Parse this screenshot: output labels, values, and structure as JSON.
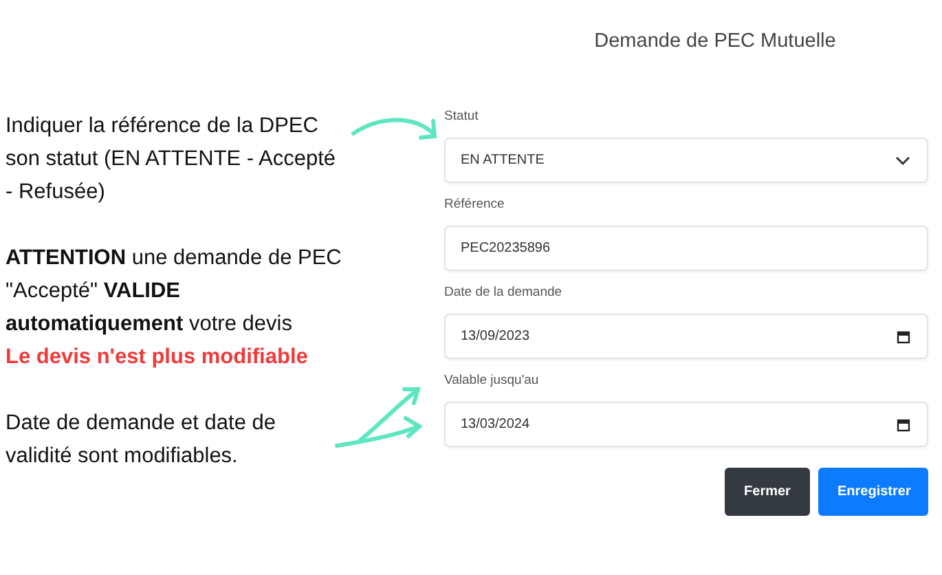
{
  "notes": [
    {
      "parts": [
        {
          "kind": "text",
          "text": "Indiquer la référence de la DPEC son statut (EN ATTENTE - Accepté - Refusée)"
        }
      ]
    },
    {
      "parts": [
        {
          "kind": "text",
          "text": "**ATTENTION** une demande de PEC \"Accepté\" **VALIDE automatiquement** votre devis"
        },
        {
          "kind": "warning",
          "text": "Le devis n'est plus modifiable"
        }
      ]
    },
    {
      "parts": [
        {
          "kind": "text",
          "text": "Date de demande et date de validité sont modifiables."
        }
      ]
    }
  ],
  "dialog": {
    "title": "Demande de PEC Mutuelle",
    "fields": [
      {
        "kind": "select",
        "label": "Statut",
        "value": "EN ATTENTE"
      },
      {
        "kind": "text",
        "label": "Référence",
        "value": "PEC20235896"
      },
      {
        "kind": "date",
        "label": "Date de la demande",
        "value": "13/09/2023"
      },
      {
        "kind": "date",
        "label": "Valable jusqu'au",
        "value": "13/03/2024"
      }
    ],
    "buttons": [
      {
        "kind": "secondary",
        "label": "Fermer"
      },
      {
        "kind": "primary",
        "label": "Enregistrer"
      }
    ]
  }
}
